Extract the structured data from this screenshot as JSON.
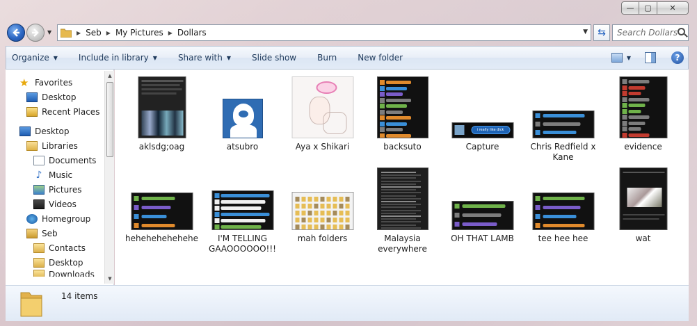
{
  "window": {
    "caption_min": "—",
    "caption_max": "▢",
    "caption_close": "✕"
  },
  "address": {
    "crumbs": [
      "Seb",
      "My Pictures",
      "Dollars"
    ],
    "search_placeholder": "Search Dollars"
  },
  "toolbar": {
    "organize": "Organize",
    "include": "Include in library",
    "share": "Share with",
    "slideshow": "Slide show",
    "burn": "Burn",
    "newfolder": "New folder",
    "help": "?"
  },
  "nav": {
    "favorites": "Favorites",
    "desktop_fav": "Desktop",
    "recent": "Recent Places",
    "desktop": "Desktop",
    "libraries": "Libraries",
    "documents": "Documents",
    "music": "Music",
    "pictures": "Pictures",
    "videos": "Videos",
    "homegroup": "Homegroup",
    "seb": "Seb",
    "contacts": "Contacts",
    "desktop2": "Desktop",
    "downloads": "Downloads"
  },
  "files": [
    "aklsdg;oag",
    "atsubro",
    "Aya x Shikari",
    "backsuto",
    "Capture",
    "Chris Redfield x Kane",
    "evidence",
    "hehehehehehehe",
    "I'M TELLING GAAOOOOOO!!!",
    "mah folders",
    "Malaysia everywhere",
    "OH THAT LAMB",
    "tee hee hee",
    "wat"
  ],
  "capture_text": "i really like dick",
  "status": {
    "count": "14 items"
  },
  "colors": {
    "toolbar_text": "#1e395b",
    "chat_green": "#6fb24a",
    "chat_blue": "#3a8fd8",
    "chat_purple": "#7a5cc9",
    "chat_orange": "#e08a2c",
    "chat_red": "#c23b2f",
    "chat_grey": "#7d7d7d"
  }
}
